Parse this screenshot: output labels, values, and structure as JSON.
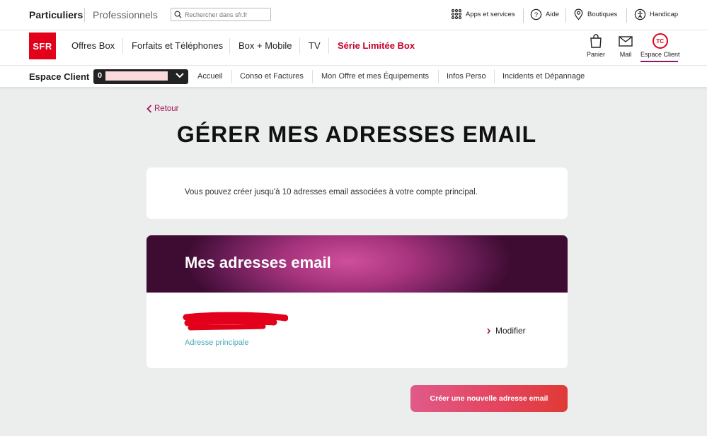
{
  "topbar": {
    "particuliers": "Particuliers",
    "professionnels": "Professionnels",
    "search_placeholder": "Rechercher dans sfr.fr",
    "utils": [
      {
        "label": "Apps et services",
        "icon": "grid-icon"
      },
      {
        "label": "Aide",
        "icon": "help-icon"
      },
      {
        "label": "Boutiques",
        "icon": "location-pin-icon"
      },
      {
        "label": "Handicap",
        "icon": "accessibility-icon"
      }
    ]
  },
  "mainnav": {
    "logo": "SFR",
    "items": [
      "Offres Box",
      "Forfaits et Téléphones",
      "Box + Mobile",
      "TV",
      "Série Limitée Box"
    ],
    "right": {
      "panier": "Panier",
      "mail": "Mail",
      "espace_client": "Espace Client",
      "espace_client_badge": "TC"
    }
  },
  "espace_client_bar": {
    "title": "Espace Client",
    "account_value": "0",
    "links": [
      "Accueil",
      "Conso et Factures",
      "Mon Offre et mes Équipements",
      "Infos Perso",
      "Incidents et Dépannage"
    ]
  },
  "main": {
    "back_label": "Retour",
    "page_title": "GÉRER MES ADRESSES EMAIL",
    "info_text": "Vous pouvez créer jusqu'à 10 adresses email associées à votre compte principal.",
    "emails_section_title": "Mes adresses email",
    "primary_label": "Adresse principale",
    "modify_label": "Modifier",
    "create_button": "Créer une nouvelle adresse email"
  },
  "colors": {
    "brand_red": "#e2001a",
    "accent_magenta": "#a0124e",
    "teal_label": "#4aa8b8",
    "background": "#eceeed"
  }
}
